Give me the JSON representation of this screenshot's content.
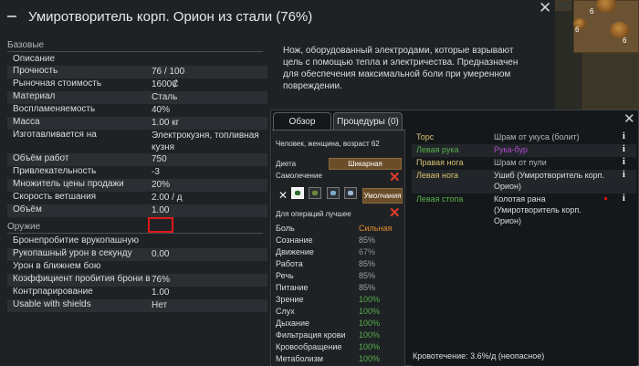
{
  "window": {
    "title": "Умиротворитель корп. Орион из стали (76%)",
    "description": "Нож, оборудованный электродами, которые взрывают цель с помощью тепла и электричества. Предназначен для обеспечения максимальной боли при умеренном повреждении."
  },
  "sections": {
    "basic": {
      "header": "Базовые",
      "rows": [
        {
          "label": "Описание",
          "value": ""
        },
        {
          "label": "Прочность",
          "value": "76 / 100"
        },
        {
          "label": "Рыночная стоимость",
          "value": "1600₡"
        },
        {
          "label": "Материал",
          "value": "Сталь"
        },
        {
          "label": "Воспламеняемость",
          "value": "40%"
        },
        {
          "label": "Масса",
          "value": "1.00 кг"
        },
        {
          "label": "Изготавливается на",
          "value": "Электрокузня, топливная кузня"
        },
        {
          "label": "Объём работ",
          "value": "750"
        },
        {
          "label": "Привлекательность",
          "value": "-3"
        },
        {
          "label": "Множитель цены продажи",
          "value": "20%"
        },
        {
          "label": "Скорость ветшания",
          "value": "2.00 / д"
        },
        {
          "label": "Объём",
          "value": "1.00"
        }
      ]
    },
    "weapon": {
      "header": "Оружие",
      "rows": [
        {
          "label": "Бронепробитие врукопашную",
          "value": ""
        },
        {
          "label": "Рукопашный урон в секунду",
          "value": "0.00"
        },
        {
          "label": "Урон в ближнем бою",
          "value": ""
        },
        {
          "label": "Коэффициент пробития брони в",
          "value": "76%"
        },
        {
          "label": "Контрпарирование",
          "value": "1.00"
        },
        {
          "label": "Usable with shields",
          "value": "Нет"
        }
      ]
    }
  },
  "map": {
    "counts": [
      "6",
      "6",
      "6"
    ]
  },
  "health": {
    "tabs": [
      "Обзор",
      "Процедуры (0)"
    ],
    "pawn_info": "Человек, женщина, возраст 62",
    "diet_label": "Диета",
    "diet_value": "Шикарная",
    "self_tend_label": "Самолечение",
    "medicine_button": "Умолчания",
    "ops_label": "Для операций лучшее",
    "capacities": [
      {
        "label": "Боль",
        "value": "Сильная",
        "color": "#e08a2a"
      },
      {
        "label": "Сознание",
        "value": "85%",
        "color": "#a0a0a0"
      },
      {
        "label": "Движение",
        "value": "67%",
        "color": "#8c8c8c"
      },
      {
        "label": "Работа",
        "value": "85%",
        "color": "#a0a0a0"
      },
      {
        "label": "Речь",
        "value": "85%",
        "color": "#a0a0a0"
      },
      {
        "label": "Питание",
        "value": "85%",
        "color": "#a0a0a0"
      },
      {
        "label": "Зрение",
        "value": "100%",
        "color": "#58b04a"
      },
      {
        "label": "Слух",
        "value": "100%",
        "color": "#58b04a"
      },
      {
        "label": "Дыхание",
        "value": "100%",
        "color": "#58b04a"
      },
      {
        "label": "Фильтрация крови",
        "value": "100%",
        "color": "#58b04a"
      },
      {
        "label": "Кровообращение",
        "value": "100%",
        "color": "#58b04a"
      },
      {
        "label": "Метаболизм",
        "value": "100%",
        "color": "#58b04a"
      }
    ],
    "hediffs": [
      {
        "part": "Торс",
        "part_color": "#d8c070",
        "injury": "Шрам от укуса (болит)",
        "injury_color": "#b4b4b4",
        "info": "i"
      },
      {
        "part": "Левая рука",
        "part_color": "#58b04a",
        "injury": "Рука-бур",
        "injury_color": "#b04ad0",
        "info": "i"
      },
      {
        "part": "Правая нога",
        "part_color": "#d8c070",
        "injury": "Шрам от пули",
        "injury_color": "#b4b4b4",
        "info": "i"
      },
      {
        "part": "Левая нога",
        "part_color": "#d8c070",
        "injury": "Ушиб (Умиротворитель корп. Орион)",
        "injury_color": "#dcdcdc",
        "info": "i"
      },
      {
        "part": "Левая стопа",
        "part_color": "#58b04a",
        "injury": "Колотая рана (Умиротворитель корп. Орион)",
        "injury_color": "#dcdcdc",
        "info": "i"
      }
    ],
    "bleeding": "Кровотечение: 3.6%/д (неопасное)"
  },
  "icons": {
    "close": "close-icon",
    "minimize": "collapse-icon",
    "info": "info-icon",
    "remove": "remove-icon"
  }
}
